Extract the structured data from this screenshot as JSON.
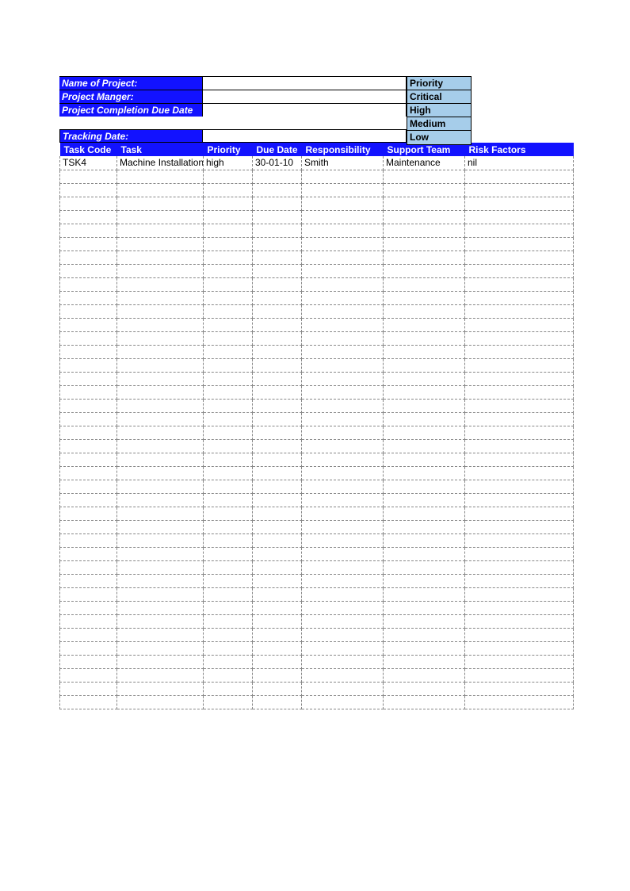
{
  "info": {
    "name_label": "Name of Project:",
    "name_value": "",
    "manager_label": "Project Manger:",
    "manager_value": "",
    "due_label": "Project Completion Due Date",
    "due_value": ""
  },
  "priority_box": {
    "header": "Priority",
    "levels": [
      "Critical",
      "High",
      "Medium",
      "Low"
    ]
  },
  "tracking": {
    "label": "Tracking Date:",
    "value": ""
  },
  "table": {
    "headers": [
      "Task Code",
      "Task",
      "Priority",
      "Due Date",
      "Responsibility",
      "Support Team",
      "Risk Factors"
    ],
    "rows": [
      [
        "TSK4",
        "Machine Installation",
        "high",
        "30-01-10",
        "Smith",
        "Maintenance",
        "nil"
      ]
    ],
    "empty_rows": 40
  }
}
